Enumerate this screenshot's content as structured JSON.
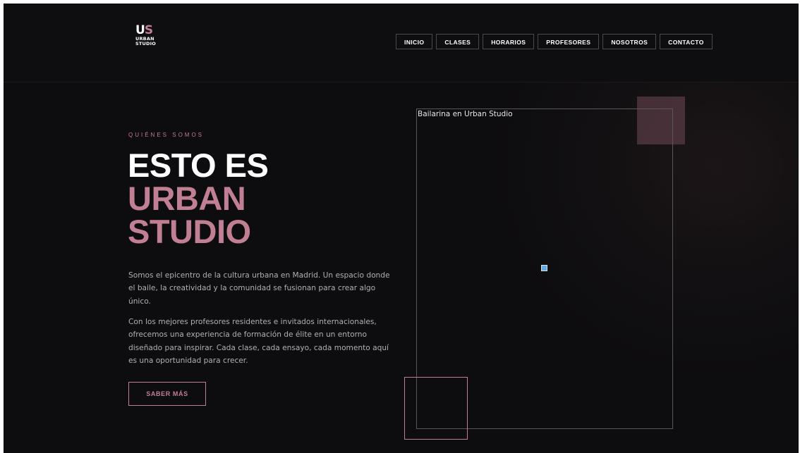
{
  "brand": {
    "logo_letters_u": "U",
    "logo_letters_s": "S",
    "logo_line1": "URBAN",
    "logo_line2": "STUDIO",
    "accent_color": "#c17f93"
  },
  "nav": {
    "items": [
      {
        "label": "INICIO"
      },
      {
        "label": "CLASES"
      },
      {
        "label": "HORARIOS"
      },
      {
        "label": "PROFESORES"
      },
      {
        "label": "NOSOTROS"
      },
      {
        "label": "CONTACTO"
      }
    ]
  },
  "about": {
    "eyebrow": "QUIÉNES SOMOS",
    "title_line1": "ESTO ES",
    "title_line2": "URBAN",
    "title_line3": "STUDIO",
    "paragraph1": "Somos el epicentro de la cultura urbana en Madrid. Un espacio donde el baile, la creatividad y la comunidad se fusionan para crear algo único.",
    "paragraph2": "Con los mejores profesores residentes e invitados internacionales, ofrecemos una experiencia de formación de élite en un entorno diseñado para inspirar. Cada clase, cada ensayo, cada momento aquí es una oportunidad para crecer.",
    "button_label": "SABER MÁS"
  },
  "image": {
    "alt_text": "Bailarina en Urban Studio",
    "icon": "broken-image-icon"
  }
}
